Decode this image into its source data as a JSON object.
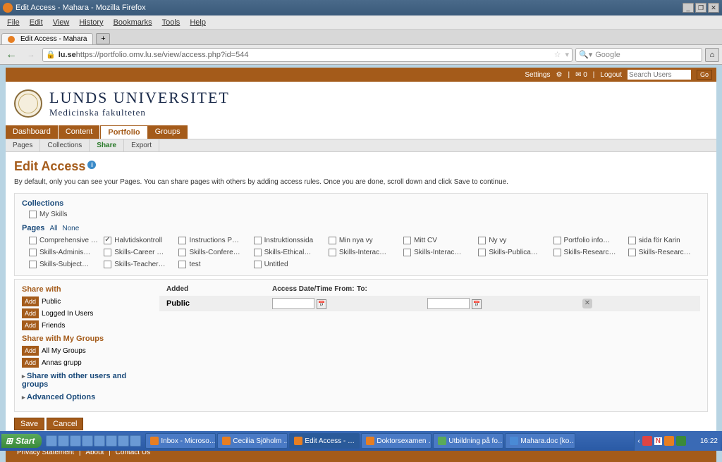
{
  "window": {
    "title": "Edit Access - Mahara - Mozilla Firefox"
  },
  "ff": {
    "menus": [
      "File",
      "Edit",
      "View",
      "History",
      "Bookmarks",
      "Tools",
      "Help"
    ],
    "tab": "Edit Access - Mahara",
    "newtab": "+",
    "url_host": "lu.se",
    "url_path": " https://portfolio.omv.lu.se/view/access.php?id=544",
    "search_engine": "Google",
    "back": "←",
    "fwd": "→",
    "home": "⌂"
  },
  "topbar": {
    "settings": "Settings",
    "inbox": "✉ 0",
    "logout": "Logout",
    "search_ph": "Search Users",
    "go": "Go"
  },
  "uni": {
    "name": "LUNDS UNIVERSITET",
    "sub": "Medicinska fakulteten"
  },
  "nav": {
    "items": [
      "Dashboard",
      "Content",
      "Portfolio",
      "Groups"
    ],
    "active": 2
  },
  "subnav": {
    "items": [
      "Pages",
      "Collections",
      "Share",
      "Export"
    ],
    "active": 2
  },
  "title": "Edit Access",
  "desc": "By default, only you can see your Pages. You can share pages with others by adding access rules. Once you are done, scroll down and click Save to continue.",
  "collections": {
    "label": "Collections",
    "items": [
      "My Skills"
    ]
  },
  "pages": {
    "label": "Pages",
    "all": "All",
    "none": "None",
    "items": [
      {
        "label": "Comprehensive …",
        "checked": false
      },
      {
        "label": "Halvtidskontroll",
        "checked": true
      },
      {
        "label": "Instructions P…",
        "checked": false
      },
      {
        "label": "Instruktionssida",
        "checked": false
      },
      {
        "label": "Min nya vy",
        "checked": false
      },
      {
        "label": "Mitt CV",
        "checked": false
      },
      {
        "label": "Ny vy",
        "checked": false
      },
      {
        "label": "Portfolio info…",
        "checked": false
      },
      {
        "label": "sida för Karin",
        "checked": false
      },
      {
        "label": "Skills-Adminis…",
        "checked": false
      },
      {
        "label": "Skills-Career …",
        "checked": false
      },
      {
        "label": "Skills-Confere…",
        "checked": false
      },
      {
        "label": "Skills-Ethical…",
        "checked": false
      },
      {
        "label": "Skills-Interac…",
        "checked": false
      },
      {
        "label": "Skills-Interac…",
        "checked": false
      },
      {
        "label": "Skills-Publica…",
        "checked": false
      },
      {
        "label": "Skills-Researc…",
        "checked": false
      },
      {
        "label": "Skills-Researc…",
        "checked": false
      },
      {
        "label": "Skills-Subject…",
        "checked": false
      },
      {
        "label": "Skills-Teacher…",
        "checked": false
      },
      {
        "label": "test",
        "checked": false
      },
      {
        "label": "Untitled",
        "checked": false
      }
    ]
  },
  "share": {
    "label": "Share with",
    "add": "Add",
    "items": [
      "Public",
      "Logged In Users",
      "Friends"
    ],
    "groups_label": "Share with My Groups",
    "groups": [
      "All My Groups",
      "Annas grupp"
    ],
    "other": "Share with other users and groups",
    "advanced": "Advanced Options",
    "table": {
      "added": "Added",
      "fromlabel": "Access Date/Time From:",
      "to": "To:",
      "row_label": "Public",
      "from_val": "",
      "to_val": ""
    }
  },
  "buttons": {
    "save": "Save",
    "cancel": "Cancel"
  },
  "footer": {
    "privacy": "Privacy Statement",
    "about": "About",
    "contact": "Contact Us"
  },
  "taskbar": {
    "start": "Start",
    "tasks": [
      "Inbox - Microso…",
      "Cecilia Sjöholm …",
      "Edit Access - …",
      "Doktorsexamen …",
      "Utbildning på fo…",
      "Mahara.doc [ko…"
    ],
    "active_task": 2,
    "clock": "16:22",
    "tray_text": "N"
  }
}
